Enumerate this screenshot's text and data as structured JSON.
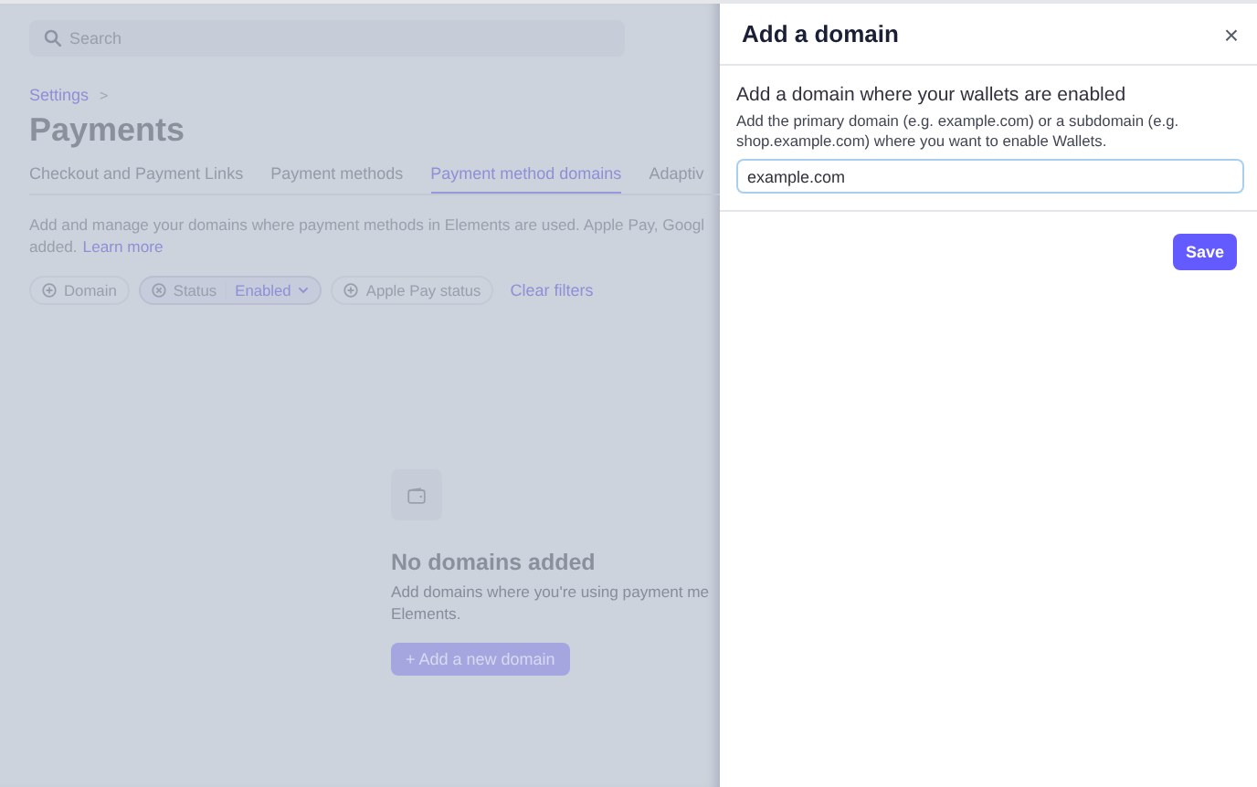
{
  "search": {
    "placeholder": "Search"
  },
  "breadcrumb": {
    "label": "Settings",
    "separator": ">"
  },
  "page_title": "Payments",
  "tabs": [
    {
      "label": "Checkout and Payment Links",
      "selected": false
    },
    {
      "label": "Payment methods",
      "selected": false
    },
    {
      "label": "Payment method domains",
      "selected": true
    },
    {
      "label": "Adaptiv",
      "selected": false
    }
  ],
  "description": {
    "text": "Add and manage your domains where payment methods in Elements are used. Apple Pay, Googl",
    "continuation": "added.",
    "link": "Learn more"
  },
  "filters": [
    {
      "label": "Domain",
      "active": false
    },
    {
      "label": "Status",
      "active": true,
      "value": "Enabled"
    },
    {
      "label": "Apple Pay status",
      "active": false
    }
  ],
  "clear_filters": "Clear filters",
  "empty_state": {
    "title": "No domains added",
    "lines": [
      "Add domains where you're using payment me",
      "Elements."
    ],
    "button": "+ Add a new domain"
  },
  "panel": {
    "title": "Add a domain",
    "close": "×",
    "heading": "Add a domain where your wallets are enabled",
    "text": "Add the primary domain (e.g. example.com) or a subdomain (e.g. shop.example.com) where you want to enable Wallets.",
    "field": {
      "value": "example.com",
      "focused": true
    },
    "save": "Save"
  }
}
